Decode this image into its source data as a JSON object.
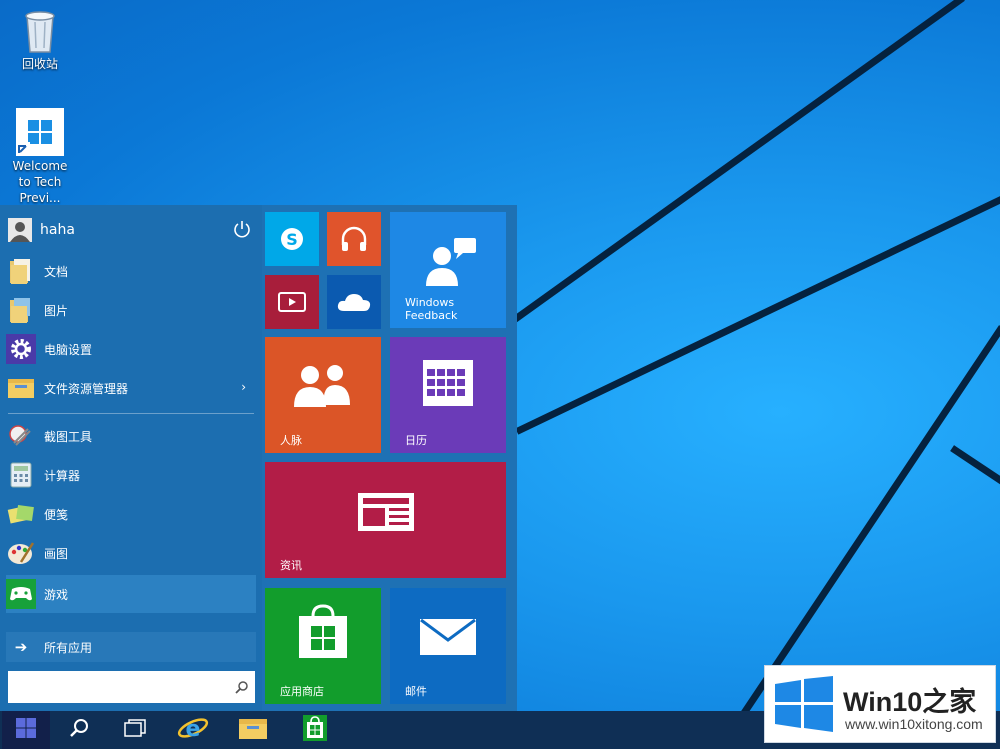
{
  "desktop": {
    "icons": [
      {
        "label": "回收站",
        "icon": "recycle-bin-icon"
      },
      {
        "label": "Welcome to Tech Previ...",
        "icon": "windows-logo-icon"
      }
    ]
  },
  "start_menu": {
    "user": {
      "name": "haha"
    },
    "places": [
      {
        "label": "文档",
        "icon": "documents-folder-icon"
      },
      {
        "label": "图片",
        "icon": "pictures-folder-icon"
      },
      {
        "label": "电脑设置",
        "icon": "settings-gear-icon"
      },
      {
        "label": "文件资源管理器",
        "icon": "file-explorer-icon",
        "submenu": "›"
      }
    ],
    "apps": [
      {
        "label": "截图工具",
        "icon": "snipping-tool-icon"
      },
      {
        "label": "计算器",
        "icon": "calculator-icon"
      },
      {
        "label": "便笺",
        "icon": "sticky-notes-icon"
      },
      {
        "label": "画图",
        "icon": "paint-icon"
      },
      {
        "label": "游戏",
        "icon": "games-icon",
        "highlighted": true
      }
    ],
    "all_apps": {
      "label": "所有应用",
      "icon": "arrow-right-icon"
    },
    "search": {
      "placeholder": ""
    },
    "tiles": {
      "skype": {
        "label": "",
        "color": "#00a8e8"
      },
      "music": {
        "label": "",
        "color": "#e0542c"
      },
      "video": {
        "label": "",
        "color": "#a81e3b"
      },
      "onedrive": {
        "label": "",
        "color": "#0b5ab0"
      },
      "feedback": {
        "label": "Windows Feedback",
        "color": "#1e88e5"
      },
      "people": {
        "label": "人脉",
        "color": "#db5527"
      },
      "calendar": {
        "label": "日历",
        "color": "#6b3bb8"
      },
      "news": {
        "label": "资讯",
        "color": "#b21d47"
      },
      "store": {
        "label": "应用商店",
        "color": "#129d2c"
      },
      "mail": {
        "label": "邮件",
        "color": "#0d6bc2"
      }
    }
  },
  "taskbar": {
    "buttons": [
      "start-button",
      "search-button",
      "task-view-button",
      "internet-explorer-button",
      "file-explorer-button",
      "store-button"
    ]
  },
  "watermark": {
    "title": "Win10之家",
    "url": "www.win10xitong.com"
  },
  "colors": {
    "accent": "#1e71b4",
    "taskbar": "#0f2f55",
    "desktop": "#1a8fe3"
  }
}
